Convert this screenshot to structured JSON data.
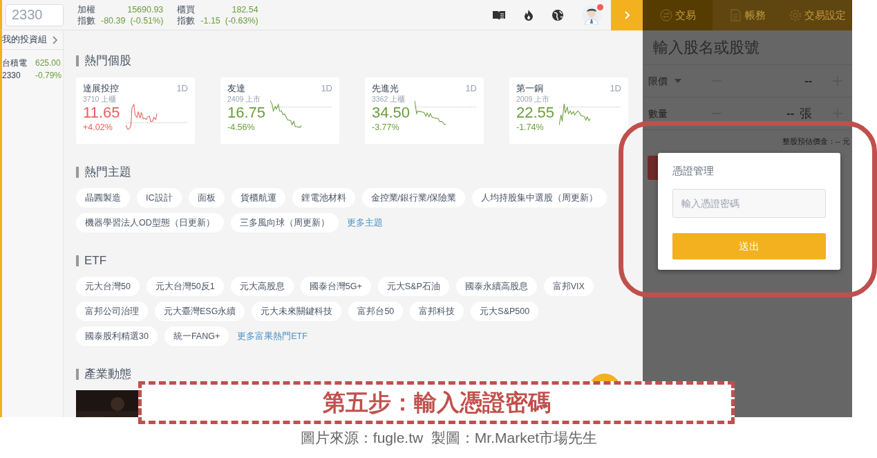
{
  "search": {
    "value": "2330"
  },
  "indices": [
    {
      "name_top": "加權",
      "name_bottom": "指數",
      "value": "15690.93",
      "change": "-80.39",
      "pct": "(-0.51%)",
      "color": "#6a9e3a"
    },
    {
      "name_top": "櫃買",
      "name_bottom": "指數",
      "value": "182.54",
      "change": "-1.15",
      "pct": "(-0.63%)",
      "color": "#6a9e3a"
    }
  ],
  "avatar": {
    "notification": true
  },
  "sidebar": {
    "title": "我的投資組",
    "holdings": [
      {
        "name": "台積電",
        "price": "625.00",
        "code": "2330",
        "change": "-0.79%",
        "color": "#6a9e3a"
      }
    ]
  },
  "hot_stocks": {
    "heading": "熱門個股",
    "stocks": [
      {
        "name": "達展投控",
        "market": "3710 上櫃",
        "period": "1D",
        "price": "11.65",
        "change": "+4.02%",
        "color": "#e8605a"
      },
      {
        "name": "友達",
        "market": "2409 上市",
        "period": "1D",
        "price": "16.75",
        "change": "-4.56%",
        "color": "#6a9e3a"
      },
      {
        "name": "先進光",
        "market": "3362 上櫃",
        "period": "1D",
        "price": "34.50",
        "change": "-3.77%",
        "color": "#6a9e3a"
      },
      {
        "name": "第一銅",
        "market": "2009 上市",
        "period": "1D",
        "price": "22.55",
        "change": "-1.74%",
        "color": "#6a9e3a"
      }
    ]
  },
  "themes": {
    "heading": "熱門主題",
    "tags": [
      "晶圓製造",
      "IC設計",
      "面板",
      "貨櫃航運",
      "鋰電池材料",
      "金控業/銀行業/保險業",
      "人均持股集中選股（周更新）",
      "機器學習法人OD型態（日更新）",
      "三多風向球（周更新）"
    ],
    "more_link": "更多主題"
  },
  "etf": {
    "heading": "ETF",
    "tags": [
      "元大台灣50",
      "元大台灣50反1",
      "元大高股息",
      "國泰台灣5G+",
      "元大S&P石油",
      "國泰永續高股息",
      "富邦VIX",
      "富邦公司治理",
      "元大臺灣ESG永續",
      "元大未來關鍵科技",
      "富邦台50",
      "富邦科技",
      "元大S&P500",
      "國泰股利精選30",
      "統一FANG+"
    ],
    "more_link": "更多富果熱門ETF"
  },
  "industry": {
    "heading": "產業動態"
  },
  "trade_panel": {
    "tabs": [
      {
        "label": "交易",
        "selected": true
      },
      {
        "label": "帳務",
        "selected": false
      },
      {
        "label": "交易設定",
        "selected": false
      }
    ],
    "stock_input": {
      "placeholder": "輸入股名或股號"
    },
    "price_row": {
      "label": "限價",
      "value": "--"
    },
    "qty_row": {
      "label": "數量",
      "value": "--",
      "unit": "張"
    },
    "estimate": "整股預估價金：-- 元"
  },
  "dialog": {
    "title": "憑證管理",
    "password": {
      "placeholder": "輸入憑證密碼"
    },
    "submit": "送出"
  },
  "annotation": {
    "step": "第五步：輸入憑證密碼",
    "credit": "圖片來源：fugle.tw  製圖：Mr.Market市場先生"
  }
}
